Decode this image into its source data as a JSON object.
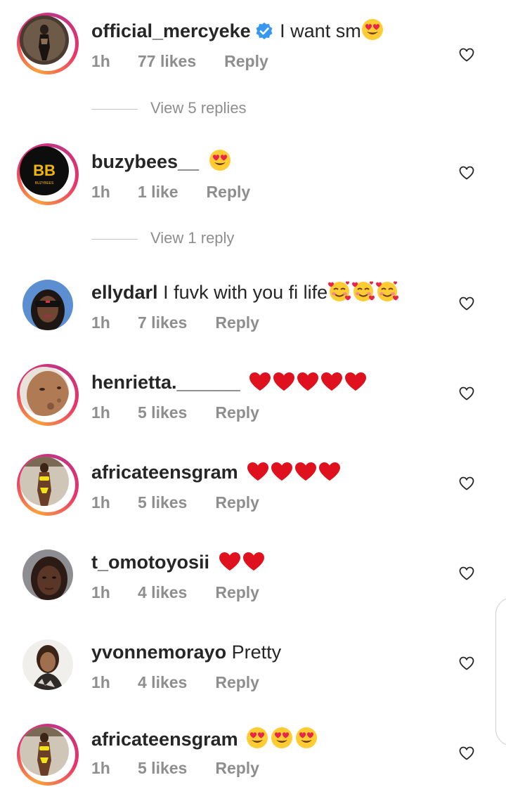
{
  "colors": {
    "text": "#262626",
    "muted": "#8e8e8e",
    "verified": "#3897f0",
    "heart_red": "#e0111f",
    "story_ring": [
      "#f9a23b",
      "#e8336b",
      "#c13584"
    ]
  },
  "icons": {
    "like": "heart-outline-icon",
    "verified": "verified-badge-icon",
    "emoji_heart_eyes": "heart-eyes-emoji",
    "emoji_hearts_face": "smiling-face-with-hearts-emoji",
    "emoji_red_heart": "red-heart-emoji"
  },
  "comments": [
    {
      "username": "official_mercyeke",
      "verified": true,
      "text": "I want sm",
      "emojis": [
        "heart-eyes"
      ],
      "time": "1h",
      "likes": "77 likes",
      "reply": "Reply",
      "story_ring": true,
      "view_replies": "View 5 replies"
    },
    {
      "username": "buzybees__",
      "verified": false,
      "text": "",
      "emojis": [
        "heart-eyes"
      ],
      "time": "1h",
      "likes": "1 like",
      "reply": "Reply",
      "story_ring": true,
      "view_replies": "View 1 reply"
    },
    {
      "username": "ellydarl",
      "verified": false,
      "text": "I fuvk with you fi life",
      "emojis": [
        "hearts-face",
        "hearts-face",
        "hearts-face"
      ],
      "time": "1h",
      "likes": "7 likes",
      "reply": "Reply",
      "story_ring": false
    },
    {
      "username": "henrietta.______",
      "verified": false,
      "text": "",
      "emojis": [
        "red-heart",
        "red-heart",
        "red-heart",
        "red-heart",
        "red-heart"
      ],
      "time": "1h",
      "likes": "5 likes",
      "reply": "Reply",
      "story_ring": true
    },
    {
      "username": "africateensgram",
      "verified": false,
      "text": "",
      "emojis": [
        "red-heart",
        "red-heart",
        "red-heart",
        "red-heart"
      ],
      "time": "1h",
      "likes": "5 likes",
      "reply": "Reply",
      "story_ring": true
    },
    {
      "username": "t_omotoyosii",
      "verified": false,
      "text": "",
      "emojis": [
        "red-heart",
        "red-heart"
      ],
      "time": "1h",
      "likes": "4 likes",
      "reply": "Reply",
      "story_ring": false
    },
    {
      "username": "yvonnemorayo",
      "verified": false,
      "text": "Pretty",
      "emojis": [],
      "time": "1h",
      "likes": "4 likes",
      "reply": "Reply",
      "story_ring": false
    },
    {
      "username": "africateensgram",
      "verified": false,
      "text": "",
      "emojis": [
        "heart-eyes",
        "heart-eyes",
        "heart-eyes"
      ],
      "time": "1h",
      "likes": "5 likes",
      "reply": "Reply",
      "story_ring": true
    }
  ],
  "avatar_logo_text": "BB"
}
